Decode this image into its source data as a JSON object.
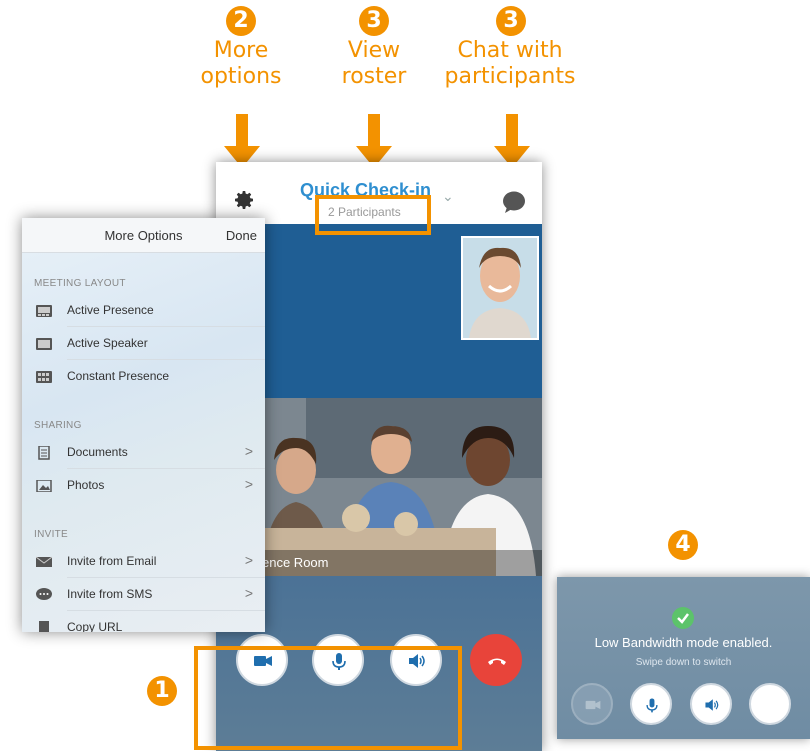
{
  "callouts": {
    "more_options": {
      "number": "2",
      "line1": "More",
      "line2": "options"
    },
    "view_roster": {
      "number": "3",
      "line1": "View",
      "line2": "roster"
    },
    "chat": {
      "number": "3",
      "line1": "Chat with",
      "line2": "participants"
    },
    "controls": {
      "number": "1"
    },
    "low_bandwidth": {
      "number": "4"
    }
  },
  "meeting": {
    "title": "Quick Check-in",
    "participants": "2 Participants",
    "room_label": "ence Room"
  },
  "more_options": {
    "title": "More Options",
    "done": "Done",
    "sections": [
      {
        "header": "MEETING LAYOUT",
        "items": [
          {
            "label": "Active Presence",
            "icon": "layout-icon",
            "chevron": ""
          },
          {
            "label": "Active Speaker",
            "icon": "layout-icon",
            "chevron": ""
          },
          {
            "label": "Constant Presence",
            "icon": "grid-icon",
            "chevron": ""
          }
        ]
      },
      {
        "header": "SHARING",
        "items": [
          {
            "label": "Documents",
            "icon": "document-icon",
            "chevron": ">"
          },
          {
            "label": "Photos",
            "icon": "photo-icon",
            "chevron": ">"
          }
        ]
      },
      {
        "header": "INVITE",
        "items": [
          {
            "label": "Invite from Email",
            "icon": "envelope-icon",
            "chevron": ">"
          },
          {
            "label": "Invite from SMS",
            "icon": "sms-icon",
            "chevron": ">"
          },
          {
            "label": "Copy URL",
            "icon": "copy-icon",
            "chevron": ""
          }
        ]
      }
    ]
  },
  "low_bandwidth": {
    "message": "Low Bandwidth mode enabled.",
    "sub": "Swipe down to switch"
  },
  "colors": {
    "accent": "#f39200",
    "link": "#2f8fd0",
    "end_call": "#e8443a",
    "video_bg": "#1f5e94"
  }
}
